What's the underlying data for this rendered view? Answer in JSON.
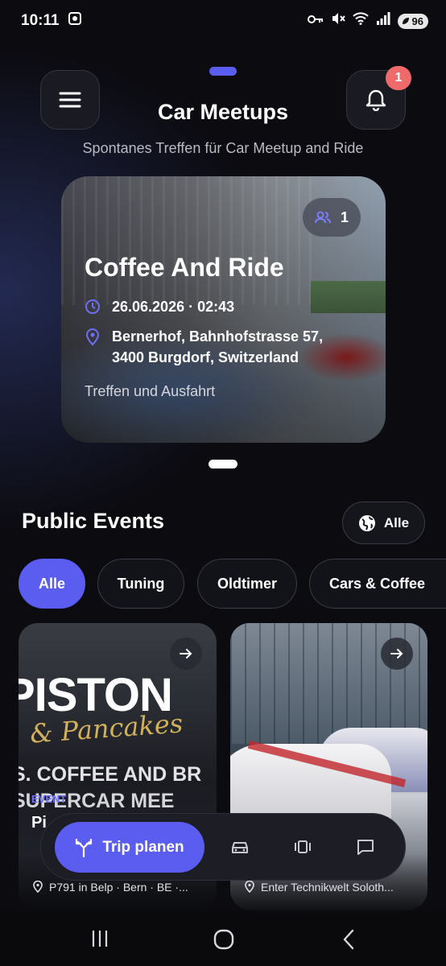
{
  "status": {
    "time": "10:11",
    "battery": "96"
  },
  "header": {
    "title": "Car Meetups",
    "subtitle": "Spontanes Treffen für Car Meetup and Ride",
    "notification_count": "1"
  },
  "featured": {
    "participants": "1",
    "title": "Coffee And Ride",
    "datetime": "26.06.2026 · 02:43",
    "location_line1": "Bernerhof, Bahnhofstrasse 57,",
    "location_line2": "3400 Burgdorf, Switzerland",
    "description": "Treffen und Ausfahrt"
  },
  "events": {
    "section_title": "Public Events",
    "scope_label": "Alle",
    "filters": [
      "Alle",
      "Tuning",
      "Oldtimer",
      "Cars & Coffee"
    ],
    "active_filter": "Alle",
    "cards": [
      {
        "poster_line1": "PISTON",
        "poster_line2": "& Pancakes",
        "poster_line3": "S. COFFEE AND BR",
        "poster_line4": "SUPERCAR MEE",
        "tag": "EVENT",
        "title_partial": "Pi",
        "location": "P791 in Belp · Bern · BE ·..."
      },
      {
        "location": "Enter Technikwelt Soloth..."
      }
    ]
  },
  "bottom_nav": {
    "primary_label": "Trip planen",
    "items": [
      "trip-fork-icon",
      "car-icon",
      "carousel-icon",
      "chat-icon"
    ]
  },
  "colors": {
    "accent": "#5b5cf0",
    "badge": "#ef6a6a",
    "background": "#0b0b10"
  }
}
